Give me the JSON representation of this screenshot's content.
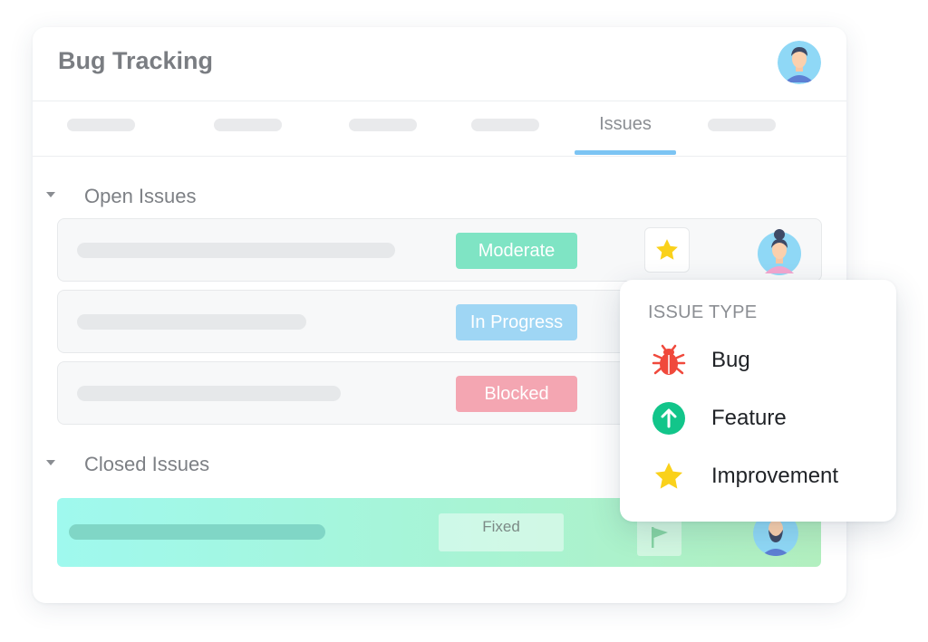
{
  "app": {
    "title": "Bug Tracking"
  },
  "tabs": {
    "active_label": "Issues"
  },
  "sections": {
    "open": {
      "title": "Open Issues",
      "rows": [
        {
          "status": "Moderate",
          "status_color": "#7fe4c4"
        },
        {
          "status": "In Progress",
          "status_color": "#9fd6f4"
        },
        {
          "status": "Blocked",
          "status_color": "#f4a6b2"
        }
      ]
    },
    "closed": {
      "title": "Closed Issues",
      "rows": [
        {
          "status": "Fixed"
        }
      ]
    }
  },
  "issue_type_menu": {
    "heading": "ISSUE TYPE",
    "items": [
      {
        "label": "Bug",
        "icon": "bug-icon",
        "color": "#f0493c"
      },
      {
        "label": "Feature",
        "icon": "arrow-up-circle-icon",
        "color": "#12c58a"
      },
      {
        "label": "Improvement",
        "icon": "star-icon",
        "color": "#fad11b"
      }
    ]
  },
  "colors": {
    "accent": "#7cc4f3",
    "star": "#fad11b"
  }
}
